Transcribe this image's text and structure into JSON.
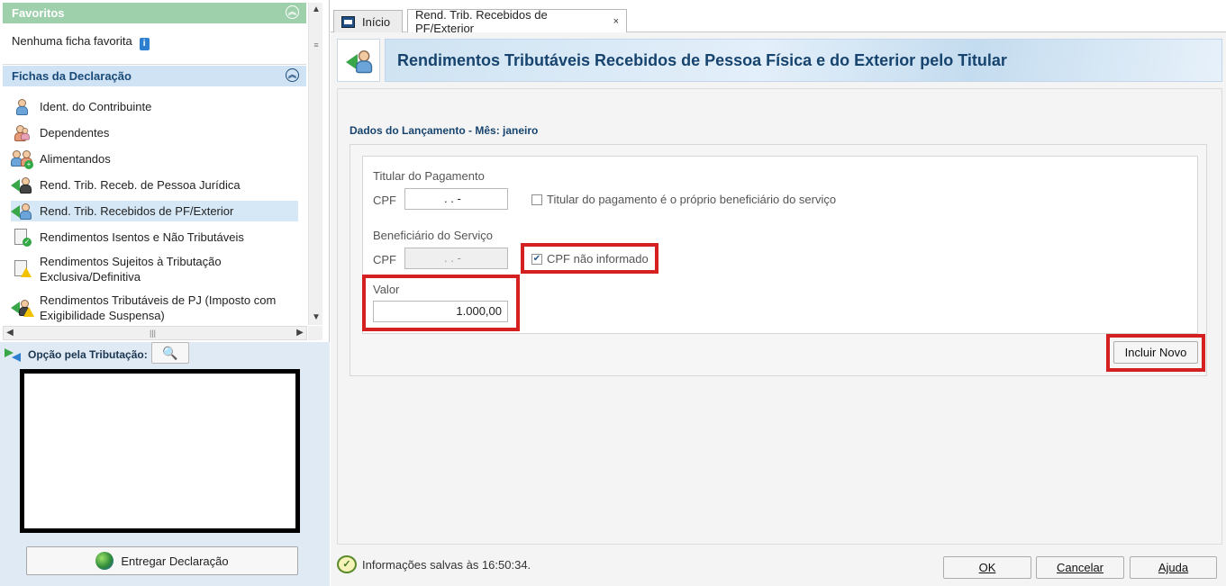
{
  "sidebar": {
    "favoritos": {
      "header": "Favoritos",
      "empty_text": "Nenhuma ficha favorita"
    },
    "fichas": {
      "header": "Fichas da Declaração",
      "items": [
        {
          "label": "Ident. do Contribuinte",
          "icon": "person-icon"
        },
        {
          "label": "Dependentes",
          "icon": "dependents-icon"
        },
        {
          "label": "Alimentandos",
          "icon": "add-person-icon"
        },
        {
          "label": "Rend. Trib. Receb. de Pessoa Jurídica",
          "icon": "income-pj-icon"
        },
        {
          "label": "Rend. Trib. Recebidos de PF/Exterior",
          "icon": "income-pf-icon",
          "active": true
        },
        {
          "label": "Rendimentos Isentos e Não Tributáveis",
          "icon": "doc-check-icon"
        },
        {
          "label": "Rendimentos Sujeitos à Tributação Exclusiva/Definitiva",
          "icon": "doc-warning-icon"
        },
        {
          "label": "Rendimentos Tributáveis de PJ (Imposto com Exigibilidade Suspensa)",
          "icon": "income-warning-icon"
        }
      ]
    },
    "opcao_label": "Opção pela Tributação:",
    "entregar_label": "Entregar Declaração"
  },
  "tabs": {
    "inicio": "Início",
    "current": "Rend. Trib. Recebidos de PF/Exterior",
    "close": "×"
  },
  "page": {
    "title": "Rendimentos Tributáveis Recebidos de Pessoa Física e do Exterior pelo Titular",
    "section_title": "Dados do Lançamento - Mês: janeiro"
  },
  "form": {
    "titular_label": "Titular do Pagamento",
    "cpf_label": "CPF",
    "titular_cpf_value": " .  .  -",
    "titular_checkbox_label": "Titular do pagamento é o próprio beneficiário do serviço",
    "titular_checkbox_checked": false,
    "beneficiario_label": "Beneficiário do Serviço",
    "beneficiario_cpf_value": " .  .  -",
    "cpf_nao_informado_label": "CPF não informado",
    "cpf_nao_informado_checked": true,
    "valor_label": "Valor",
    "valor_value": "1.000,00"
  },
  "buttons": {
    "incluir_novo": "Incluir Novo",
    "ok": "OK",
    "cancelar": "Cancelar",
    "ajuda": "Ajuda"
  },
  "status": {
    "message": "Informações salvas às 16:50:34."
  },
  "colors": {
    "favoritos_header": "#9fd0ac",
    "fichas_header": "#cfe3f4",
    "title_text": "#17446e",
    "highlight_red": "#d42020"
  }
}
